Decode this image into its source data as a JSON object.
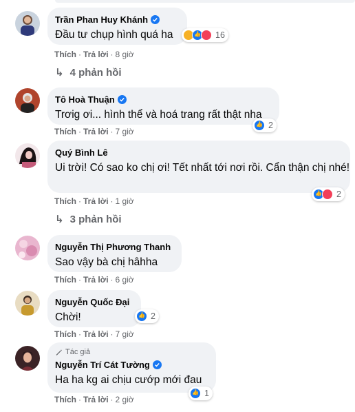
{
  "comments": [
    {
      "author": "Trần Phan Huy Khánh",
      "text": "Đầu tư chụp hình quá ha",
      "reaction_count": "16",
      "like": "Thích",
      "reply": "Trả lời",
      "time": "8 giờ",
      "replies": "4 phản hồi"
    },
    {
      "author": "Tô Hoà Thuận",
      "text": "Trơig ơi... hình thể và hoá trang rất thật nha",
      "reaction_count": "2",
      "like": "Thích",
      "reply": "Trả lời",
      "time": "7 giờ"
    },
    {
      "author": "Quý Bình Lê",
      "text": "Ui trời! Có sao ko chị ơi! Tết nhất tới nơi rồi. Cẩn thận chị nhé!",
      "reaction_count": "2",
      "like": "Thích",
      "reply": "Trả lời",
      "time": "1 giờ",
      "replies": "3 phản hồi"
    },
    {
      "author": "Nguyễn Thị Phương Thanh",
      "text": "Sao vậy bà chị hâhha",
      "like": "Thích",
      "reply": "Trả lời",
      "time": "6 giờ"
    },
    {
      "author": "Nguyễn Quốc Đại",
      "text": "Chời!",
      "reaction_count": "2",
      "like": "Thích",
      "reply": "Trả lời",
      "time": "7 giờ"
    },
    {
      "author_badge": "Tác giả",
      "author": "Nguyễn Trí Cát Tường",
      "text": "Ha ha kg ai chịu cướp mới đau",
      "reaction_count": "1",
      "like": "Thích",
      "reply": "Trả lời",
      "time": "2 giờ"
    }
  ],
  "colors": {
    "bubble": "#f0f2f5",
    "secondary_text": "#65676b",
    "like_blue": "#1877f2",
    "love_red": "#f33e58",
    "haha_yellow": "#f7b125"
  }
}
